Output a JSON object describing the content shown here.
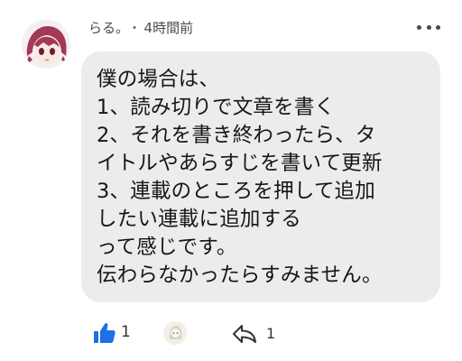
{
  "comment": {
    "author": "らる。",
    "separator": "・",
    "time": "4時間前",
    "lines": [
      "僕の場合は、",
      "1、読み切りで文章を書く",
      "2、それを書き終わったら、タ",
      "イトルやあらすじを書いて更新",
      "3、連載のところを押して追加",
      "したい連載に追加する",
      "って感じです。",
      "伝わらなかったらすみません。"
    ]
  },
  "actions": {
    "like_count": "1",
    "reply_count": "1"
  },
  "icons": {
    "avatar": "user-avatar-anime-character",
    "more": "more-horizontal-icon",
    "like": "thumbs-up-icon",
    "reply": "reply-arrow-icon"
  },
  "colors": {
    "like": "#1d70e8",
    "bubble": "#ececee"
  }
}
